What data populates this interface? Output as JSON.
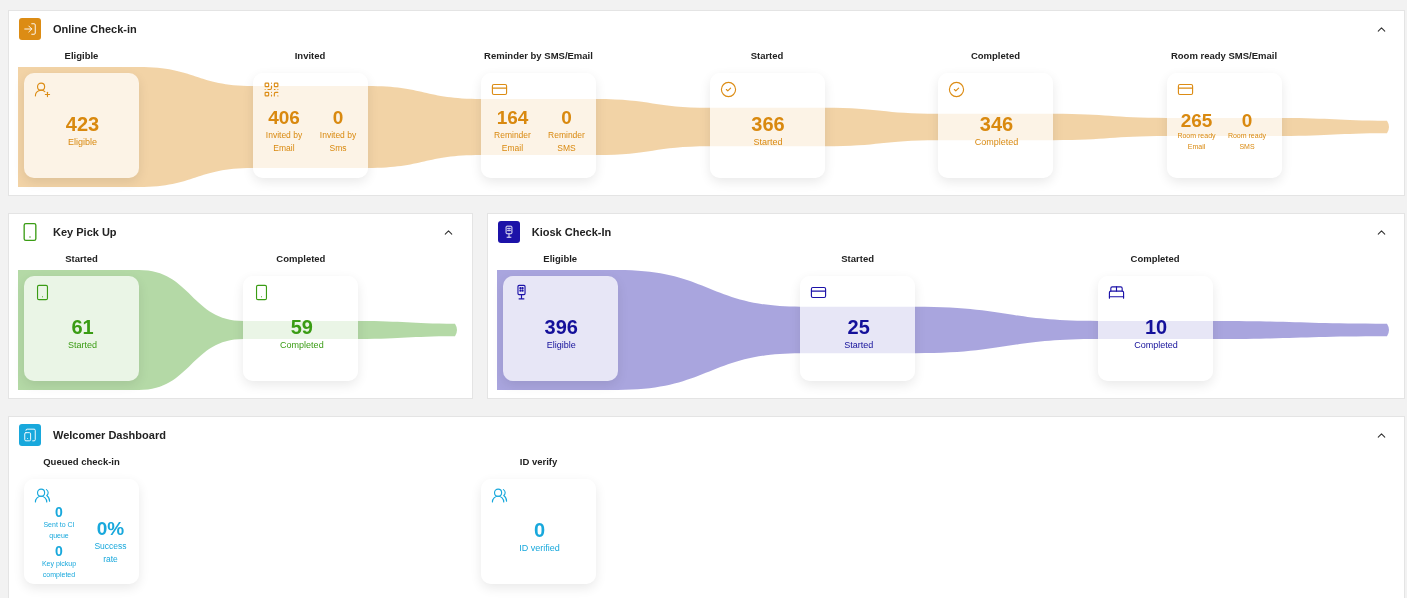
{
  "panels": [
    {
      "title": "Online Check-in",
      "color": "#dc8c14",
      "expanded": true,
      "flow": true,
      "stages": [
        {
          "label": "Eligible",
          "kind": "single",
          "metrics": [
            {
              "value": "423",
              "label": "Eligible"
            }
          ]
        },
        {
          "label": "Invited",
          "kind": "pair",
          "metrics": [
            {
              "value": "406",
              "label": "Invited by Email"
            },
            {
              "value": "0",
              "label": "Invited by Sms"
            }
          ]
        },
        {
          "label": "Reminder by SMS/Email",
          "kind": "pair",
          "metrics": [
            {
              "value": "164",
              "label": "Reminder Email"
            },
            {
              "value": "0",
              "label": "Reminder SMS"
            }
          ]
        },
        {
          "label": "Started",
          "kind": "single",
          "metrics": [
            {
              "value": "366",
              "label": "Started"
            }
          ]
        },
        {
          "label": "Completed",
          "kind": "single",
          "metrics": [
            {
              "value": "346",
              "label": "Completed"
            }
          ]
        },
        {
          "label": "Room ready SMS/Email",
          "kind": "pair-small",
          "metrics": [
            {
              "value": "265",
              "label": "Room ready Email"
            },
            {
              "value": "0",
              "label": "Room ready SMS"
            }
          ]
        }
      ]
    },
    {
      "title": "Key Pick Up",
      "color": "#3a9c14",
      "expanded": true,
      "flow": true,
      "stages": [
        {
          "label": "Started",
          "kind": "single",
          "metrics": [
            {
              "value": "61",
              "label": "Started"
            }
          ]
        },
        {
          "label": "Completed",
          "kind": "single",
          "metrics": [
            {
              "value": "59",
              "label": "Completed"
            }
          ]
        }
      ]
    },
    {
      "title": "Kiosk Check-In",
      "color": "#1c12a8",
      "expanded": true,
      "flow": true,
      "stages": [
        {
          "label": "Eligible",
          "kind": "single",
          "metrics": [
            {
              "value": "396",
              "label": "Eligible"
            }
          ]
        },
        {
          "label": "Started",
          "kind": "single",
          "metrics": [
            {
              "value": "25",
              "label": "Started"
            }
          ]
        },
        {
          "label": "Completed",
          "kind": "single",
          "metrics": [
            {
              "value": "10",
              "label": "Completed"
            }
          ]
        }
      ]
    },
    {
      "title": "Welcomer Dashboard",
      "color": "#18a8dc",
      "expanded": true,
      "flow": false,
      "stages": [
        {
          "label": "Queued check-in",
          "kind": "queue",
          "metrics": [
            {
              "value": "0",
              "label": "Sent to CI queue"
            },
            {
              "value": "0",
              "label": "Key pickup completed"
            },
            {
              "value": "0%",
              "label": "Success rate"
            }
          ]
        },
        {
          "label": "ID verify",
          "kind": "single",
          "metrics": [
            {
              "value": "0",
              "label": "ID verified"
            }
          ]
        }
      ]
    }
  ]
}
